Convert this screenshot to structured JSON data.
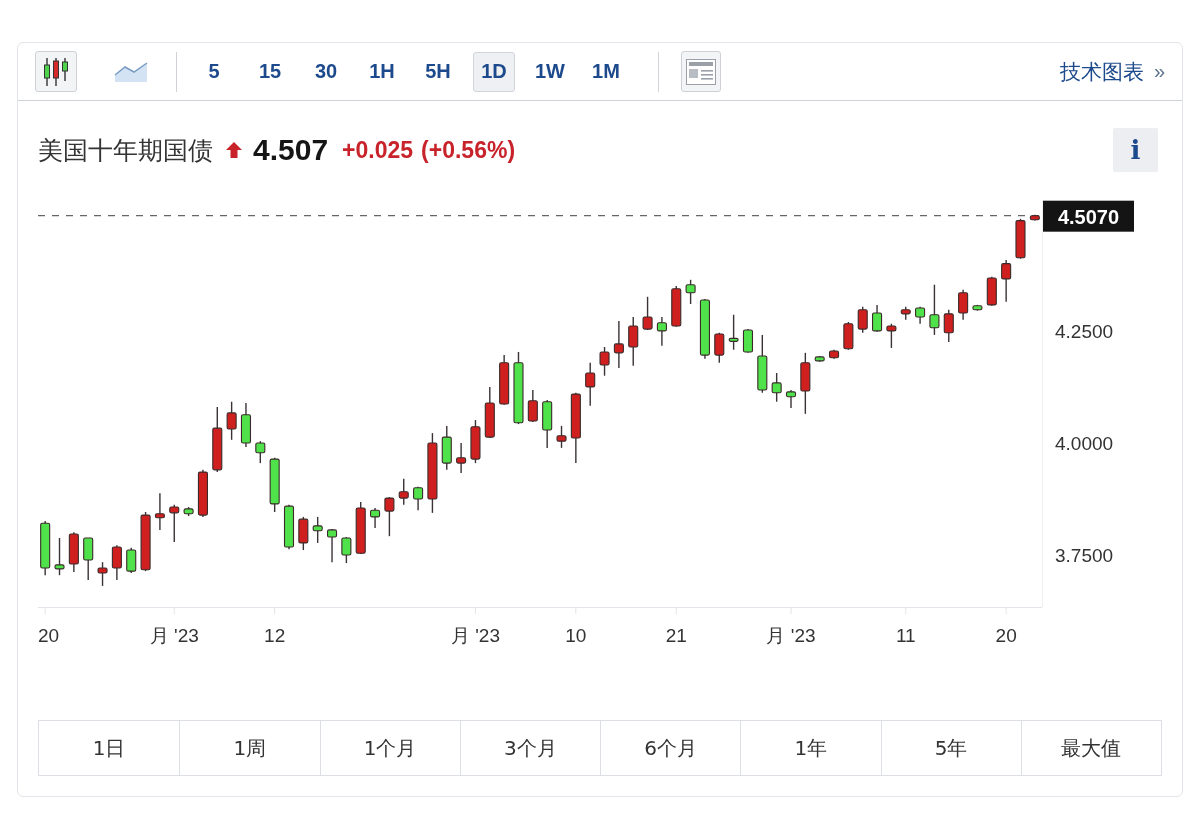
{
  "toolbar": {
    "chart_types": [
      {
        "kind": "candlestick",
        "selected": true
      },
      {
        "kind": "area",
        "selected": false
      }
    ],
    "intervals": [
      {
        "label": "5",
        "selected": false
      },
      {
        "label": "15",
        "selected": false
      },
      {
        "label": "30",
        "selected": false
      },
      {
        "label": "1H",
        "selected": false
      },
      {
        "label": "5H",
        "selected": false
      },
      {
        "label": "1D",
        "selected": true
      },
      {
        "label": "1W",
        "selected": false
      },
      {
        "label": "1M",
        "selected": false
      }
    ],
    "link": {
      "label": "技术图表",
      "chevron": "»"
    }
  },
  "quote": {
    "name": "美国十年期国债",
    "rising": true,
    "price": "4.507",
    "change": "+0.025",
    "change_percent": "(+0.56%)"
  },
  "info_button": {
    "label": "i"
  },
  "chart": {
    "chart_data": {
      "type": "candlestick",
      "categories": [
        "20",
        null,
        null,
        null,
        null,
        null,
        null,
        null,
        null,
        "月 '23",
        null,
        null,
        null,
        null,
        null,
        null,
        "12",
        null,
        null,
        null,
        null,
        null,
        null,
        null,
        null,
        null,
        null,
        null,
        null,
        null,
        "月 '23",
        null,
        null,
        null,
        null,
        null,
        null,
        "10",
        null,
        null,
        null,
        null,
        null,
        null,
        "21",
        null,
        null,
        null,
        null,
        null,
        null,
        null,
        "月 '23",
        null,
        null,
        null,
        null,
        null,
        null,
        null,
        "11",
        null,
        null,
        null,
        null,
        null,
        null,
        "20",
        null,
        null
      ],
      "ohlc": [
        [
          3.821,
          3.826,
          3.705,
          3.721
        ],
        [
          3.728,
          3.788,
          3.705,
          3.719
        ],
        [
          3.73,
          3.801,
          3.712,
          3.797
        ],
        [
          3.788,
          3.788,
          3.694,
          3.739
        ],
        [
          3.71,
          3.734,
          3.681,
          3.721
        ],
        [
          3.721,
          3.772,
          3.694,
          3.768
        ],
        [
          3.761,
          3.766,
          3.71,
          3.714
        ],
        [
          3.717,
          3.846,
          3.714,
          3.839
        ],
        [
          3.833,
          3.888,
          3.806,
          3.842
        ],
        [
          3.844,
          3.862,
          3.779,
          3.857
        ],
        [
          3.853,
          3.857,
          3.837,
          3.842
        ],
        [
          3.839,
          3.94,
          3.835,
          3.935
        ],
        [
          3.94,
          4.08,
          3.935,
          4.033
        ],
        [
          4.031,
          4.092,
          4.007,
          4.067
        ],
        [
          4.063,
          4.089,
          3.991,
          4.0
        ],
        [
          4.0,
          4.004,
          3.955,
          3.978
        ],
        [
          3.964,
          3.967,
          3.846,
          3.864
        ],
        [
          3.859,
          3.862,
          3.763,
          3.768
        ],
        [
          3.777,
          3.835,
          3.761,
          3.83
        ],
        [
          3.815,
          3.835,
          3.777,
          3.804
        ],
        [
          3.806,
          3.808,
          3.734,
          3.79
        ],
        [
          3.788,
          3.79,
          3.732,
          3.75
        ],
        [
          3.754,
          3.868,
          3.752,
          3.855
        ],
        [
          3.85,
          3.855,
          3.81,
          3.835
        ],
        [
          3.848,
          3.879,
          3.792,
          3.877
        ],
        [
          3.877,
          3.92,
          3.862,
          3.891
        ],
        [
          3.9,
          3.902,
          3.85,
          3.875
        ],
        [
          3.875,
          4.022,
          3.844,
          4.0
        ],
        [
          4.013,
          4.038,
          3.94,
          3.955
        ],
        [
          3.955,
          4.0,
          3.933,
          3.967
        ],
        [
          3.964,
          4.051,
          3.955,
          4.036
        ],
        [
          4.013,
          4.125,
          4.011,
          4.089
        ],
        [
          4.087,
          4.196,
          4.085,
          4.179
        ],
        [
          4.179,
          4.203,
          4.042,
          4.045
        ],
        [
          4.049,
          4.118,
          4.047,
          4.094
        ],
        [
          4.092,
          4.096,
          3.989,
          4.029
        ],
        [
          4.004,
          4.038,
          3.989,
          4.016
        ],
        [
          4.011,
          4.112,
          3.955,
          4.109
        ],
        [
          4.125,
          4.179,
          4.083,
          4.156
        ],
        [
          4.174,
          4.214,
          4.15,
          4.203
        ],
        [
          4.201,
          4.272,
          4.167,
          4.221
        ],
        [
          4.214,
          4.281,
          4.172,
          4.261
        ],
        [
          4.254,
          4.326,
          4.252,
          4.281
        ],
        [
          4.268,
          4.281,
          4.217,
          4.25
        ],
        [
          4.261,
          4.35,
          4.259,
          4.344
        ],
        [
          4.353,
          4.364,
          4.31,
          4.335
        ],
        [
          4.319,
          4.321,
          4.188,
          4.196
        ],
        [
          4.196,
          4.246,
          4.179,
          4.243
        ],
        [
          4.232,
          4.286,
          4.208,
          4.228
        ],
        [
          4.252,
          4.254,
          4.201,
          4.203
        ],
        [
          4.194,
          4.241,
          4.112,
          4.118
        ],
        [
          4.134,
          4.156,
          4.092,
          4.112
        ],
        [
          4.114,
          4.118,
          4.078,
          4.103
        ],
        [
          4.116,
          4.201,
          4.065,
          4.179
        ],
        [
          4.192,
          4.194,
          4.181,
          4.183
        ],
        [
          4.19,
          4.208,
          4.188,
          4.205
        ],
        [
          4.21,
          4.27,
          4.208,
          4.266
        ],
        [
          4.254,
          4.304,
          4.246,
          4.297
        ],
        [
          4.29,
          4.308,
          4.248,
          4.25
        ],
        [
          4.25,
          4.266,
          4.212,
          4.261
        ],
        [
          4.288,
          4.304,
          4.275,
          4.297
        ],
        [
          4.301,
          4.304,
          4.266,
          4.281
        ],
        [
          4.286,
          4.353,
          4.241,
          4.257
        ],
        [
          4.246,
          4.297,
          4.225,
          4.288
        ],
        [
          4.29,
          4.342,
          4.275,
          4.335
        ],
        [
          4.306,
          4.308,
          4.295,
          4.297
        ],
        [
          4.308,
          4.371,
          4.306,
          4.368
        ],
        [
          4.366,
          4.408,
          4.315,
          4.4
        ],
        [
          4.413,
          4.5,
          4.411,
          4.496
        ],
        [
          4.498,
          4.509,
          4.496,
          4.507
        ]
      ],
      "ylim": [
        3.634,
        4.542
      ],
      "yticks": [
        {
          "value": 4.25,
          "label": "4.2500"
        },
        {
          "value": 4.0,
          "label": "4.0000"
        },
        {
          "value": 3.75,
          "label": "3.7500"
        }
      ],
      "ref_lines": [
        {
          "axis": "y",
          "value": 4.507,
          "label": "4.5070"
        }
      ]
    }
  },
  "ranges": [
    {
      "label": "1日",
      "selected": false
    },
    {
      "label": "1周",
      "selected": false
    },
    {
      "label": "1个月",
      "selected": false
    },
    {
      "label": "3个月",
      "selected": false
    },
    {
      "label": "6个月",
      "selected": false
    },
    {
      "label": "1年",
      "selected": false
    },
    {
      "label": "5年",
      "selected": false
    },
    {
      "label": "最大值",
      "selected": false
    }
  ]
}
